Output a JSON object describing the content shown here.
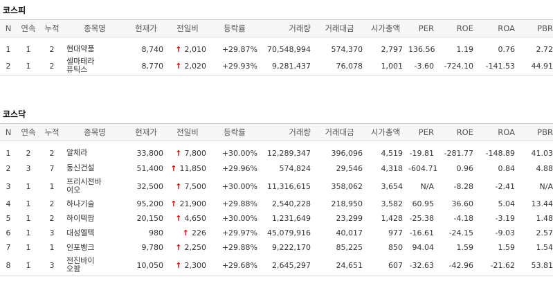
{
  "kospi": {
    "title": "코스피",
    "headers": [
      "N",
      "연속",
      "누적",
      "종목명",
      "현재가",
      "전일비",
      "등락률",
      "거래량",
      "거래대금",
      "시가총액",
      "PER",
      "ROE",
      "ROA",
      "PBR"
    ],
    "rows": [
      {
        "n": "1",
        "consec": "1",
        "cum": "2",
        "name": "현대약품",
        "price": "8,740",
        "change": "2,010",
        "rate": "+29.87%",
        "volume": "70,548,994",
        "amount": "574,370",
        "mcap": "2,797",
        "per": "136.56",
        "roe": "1.19",
        "roa": "0.76",
        "pbr": "2.72"
      },
      {
        "n": "2",
        "consec": "1",
        "cum": "2",
        "name": "셀마테라퓨틱스",
        "price": "8,770",
        "change": "2,020",
        "rate": "+29.93%",
        "volume": "9,281,437",
        "amount": "76,078",
        "mcap": "1,001",
        "per": "-3.60",
        "roe": "-724.10",
        "roa": "-141.53",
        "pbr": "44.91"
      }
    ]
  },
  "kosdaq": {
    "title": "코스닥",
    "headers": [
      "N",
      "연속",
      "누적",
      "종목명",
      "현재가",
      "전일비",
      "등락률",
      "거래량",
      "거래대금",
      "시가총액",
      "PER",
      "ROE",
      "ROA",
      "PBR"
    ],
    "rows": [
      {
        "n": "1",
        "consec": "2",
        "cum": "2",
        "name": "알체라",
        "price": "33,800",
        "change": "7,800",
        "rate": "+30.00%",
        "volume": "12,289,347",
        "amount": "396,096",
        "mcap": "4,519",
        "per": "-19.81",
        "roe": "-281.77",
        "roa": "-148.89",
        "pbr": "41.03"
      },
      {
        "n": "2",
        "consec": "3",
        "cum": "7",
        "name": "동신건설",
        "price": "51,400",
        "change": "11,850",
        "rate": "+29.96%",
        "volume": "574,824",
        "amount": "29,546",
        "mcap": "4,318",
        "per": "-604.71",
        "roe": "0.96",
        "roa": "0.84",
        "pbr": "4.88"
      },
      {
        "n": "3",
        "consec": "1",
        "cum": "1",
        "name": "프리시젼바이오",
        "price": "32,500",
        "change": "7,500",
        "rate": "+30.00%",
        "volume": "11,316,615",
        "amount": "358,062",
        "mcap": "3,654",
        "per": "N/A",
        "roe": "-8.28",
        "roa": "-2.41",
        "pbr": "N/A"
      },
      {
        "n": "4",
        "consec": "1",
        "cum": "2",
        "name": "하나기술",
        "price": "95,200",
        "change": "21,900",
        "rate": "+29.88%",
        "volume": "2,540,228",
        "amount": "218,950",
        "mcap": "3,582",
        "per": "60.95",
        "roe": "36.60",
        "roa": "5.04",
        "pbr": "13.44"
      },
      {
        "n": "5",
        "consec": "1",
        "cum": "2",
        "name": "하이텍팜",
        "price": "20,150",
        "change": "4,650",
        "rate": "+30.00%",
        "volume": "1,231,649",
        "amount": "23,299",
        "mcap": "1,428",
        "per": "-25.38",
        "roe": "-4.18",
        "roa": "-3.19",
        "pbr": "1.48"
      },
      {
        "n": "6",
        "consec": "1",
        "cum": "3",
        "name": "대성엘텍",
        "price": "980",
        "change": "226",
        "rate": "+29.97%",
        "volume": "45,079,916",
        "amount": "40,017",
        "mcap": "977",
        "per": "-16.61",
        "roe": "-24.15",
        "roa": "-9.03",
        "pbr": "2.57"
      },
      {
        "n": "7",
        "consec": "1",
        "cum": "1",
        "name": "인포뱅크",
        "price": "9,780",
        "change": "2,250",
        "rate": "+29.88%",
        "volume": "9,222,170",
        "amount": "85,225",
        "mcap": "850",
        "per": "94.04",
        "roe": "1.59",
        "roa": "1.59",
        "pbr": "1.54"
      },
      {
        "n": "8",
        "consec": "1",
        "cum": "3",
        "name": "전진바이오팜",
        "price": "10,050",
        "change": "2,300",
        "rate": "+29.68%",
        "volume": "2,645,297",
        "amount": "24,651",
        "mcap": "607",
        "per": "-32.63",
        "roe": "-42.96",
        "roa": "-21.62",
        "pbr": "53.81"
      }
    ]
  },
  "colors": {
    "up": "#d60000",
    "header_bg": "#f7f7f7",
    "border": "#c8c8c8"
  },
  "icons": {
    "up_arrow": "up-arrow-icon"
  }
}
